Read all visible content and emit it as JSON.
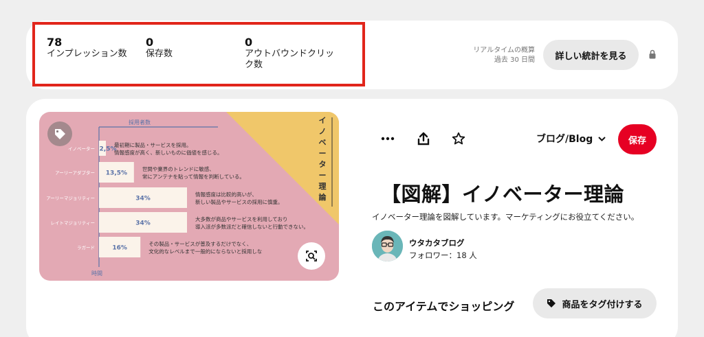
{
  "stats": {
    "impressions": {
      "value": "78",
      "label": "インプレッション数"
    },
    "saves": {
      "value": "0",
      "label": "保存数"
    },
    "outbound": {
      "value": "0",
      "label_line1": "アウトバウンドクリッ",
      "label_line2": "ク数"
    },
    "estimate_line1": "リアルタイムの概算",
    "estimate_line2": "過去 30 日間",
    "details_button": "詳しい統計を見る",
    "lock_icon": "lock-icon",
    "highlight_color": "#e1251b"
  },
  "pin": {
    "image": {
      "axis_y_label": "採用者数",
      "axis_x_label": "時間",
      "side_title": "イノベーター理論",
      "rows": [
        {
          "name": "イノベーター",
          "value": "2,5%",
          "line1": "最初期に製品・サービスを採用。",
          "line2": "情報感度が高く、新しいものに価値を感じる。",
          "share": 2.5
        },
        {
          "name": "アーリーアダプター",
          "value": "13,5%",
          "line1": "世間や業界のトレンドに敏感、",
          "line2": "常にアンテナを貼って情報を判断している。",
          "share": 13.5
        },
        {
          "name": "アーリーマジョリティー",
          "value": "34%",
          "line1": "情報感度は比較的高いが、",
          "line2": "新しい製品やサービスの採用に慎重。",
          "share": 34
        },
        {
          "name": "レイトマジョリティー",
          "value": "34%",
          "line1": "大多数が商品やサービスを利用しており",
          "line2": "導入派が多数派だと確信しないと行動できない。",
          "share": 34
        },
        {
          "name": "ラガード",
          "value": "16%",
          "line1": "その製品・サービスが普及するだけでなく、",
          "line2": "文化的なレベルまで一般的にならないと採用しな",
          "share": 16
        }
      ],
      "bg_color": "#e3a9b4",
      "accent_color": "#f0c76a",
      "tag_icon": "tag-icon",
      "lens_icon": "visual-search-icon"
    },
    "more_icon": "more-icon",
    "share_icon": "share-icon",
    "star_icon": "star-icon",
    "board_name": "ブログ/Blog",
    "save_button": "保存",
    "save_color": "#e60023",
    "title": "【図解】イノベーター理論",
    "description": "イノベーター理論を図解しています。マーケティングにお役立てください。",
    "author": {
      "name": "ウタカタブログ",
      "followers": "フォロワー：18 人"
    },
    "shop_title": "このアイテムでショッピング",
    "tag_products_button": "商品をタグ付けする"
  }
}
